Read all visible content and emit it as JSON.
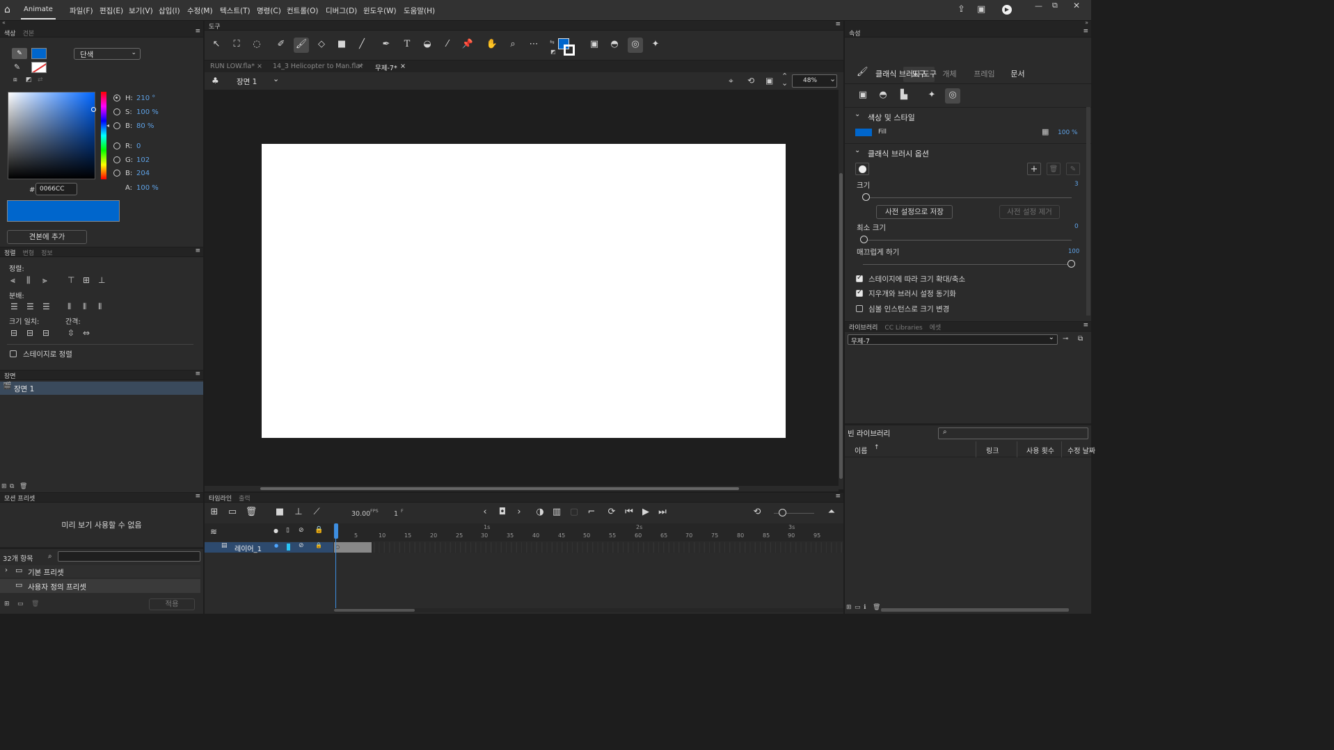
{
  "app": {
    "name": "Animate",
    "menus": [
      "파일(F)",
      "편집(E)",
      "보기(V)",
      "삽입(I)",
      "수정(M)",
      "텍스트(T)",
      "명령(C)",
      "컨트롤(O)",
      "디버그(D)",
      "윈도우(W)",
      "도움말(H)"
    ]
  },
  "color_panel": {
    "tab_active": "색상",
    "tab_inactive": "견본",
    "mode": "단색",
    "H_label": "H:",
    "H": "210 °",
    "S_label": "S:",
    "S": "100 %",
    "B_label": "B:",
    "B": "80 %",
    "R_label": "R:",
    "R": "0",
    "G_label": "G:",
    "G": "102",
    "B2_label": "B:",
    "B2": "204",
    "A_label": "A:",
    "A": "100 %",
    "hex_prefix": "#",
    "hex": "0066CC",
    "add_swatch": "견본에 추가",
    "fill_color": "#0066cc"
  },
  "align_panel": {
    "tab_active": "정렬",
    "tab2": "변형",
    "tab3": "정보",
    "align_label": "정렬:",
    "distribute_label": "분배:",
    "match_size_label": "크기 일치:",
    "space_label": "간격:",
    "to_stage": "스테이지로 정렬"
  },
  "scene_panel": {
    "title": "장면",
    "item": "장면 1"
  },
  "motion_presets": {
    "title": "모션 프리셋",
    "preview": "미리 보기 사용할 수 없음",
    "count": "32개 항목",
    "folder1": "기본 프리셋",
    "folder2": "사용자 정의 프리셋",
    "apply": "적용"
  },
  "tools_panel": {
    "title": "도구",
    "stroke_color": "#0066cc"
  },
  "doc_tabs": [
    {
      "label": "RUN LOW.fla*"
    },
    {
      "label": "14_3 Helicopter to Man.fla*"
    },
    {
      "label": "무제-7*"
    }
  ],
  "edit_bar": {
    "scene": "장면 1",
    "zoom": "48%"
  },
  "timeline": {
    "tab_active": "타임라인",
    "tab2": "출력",
    "fps": "30.00",
    "fps_unit": "FPS",
    "frame": "1",
    "frame_unit": "F",
    "layer_name": "레이어_1",
    "seconds": [
      "1s",
      "2s",
      "3s"
    ],
    "ticks": [
      "5",
      "10",
      "15",
      "20",
      "25",
      "30",
      "35",
      "40",
      "45",
      "50",
      "55",
      "60",
      "65",
      "70",
      "75",
      "80",
      "85",
      "90",
      "95"
    ]
  },
  "properties": {
    "title": "속성",
    "tabs": [
      "도구",
      "개체",
      "프레임",
      "문서"
    ],
    "tool_name": "클래식 브러시 도구",
    "section_color": "색상 및 스타일",
    "fill_label": "Fill",
    "fill_alpha": "100 %",
    "section_brush": "클래식 브러시 옵션",
    "size_label": "크기",
    "size_value": "3",
    "size_level": 0.0,
    "save_preset": "사전 설정으로 저장",
    "remove_preset": "사전 설정 제거",
    "min_size_label": "최소 크기",
    "min_size_value": "0",
    "min_size_level": 0.0,
    "smooth_label": "매끄럽게 하기",
    "smooth_value": "100",
    "smooth_level": 1.0,
    "opt1": "스테이지에 따라 크기 확대/축소",
    "opt2": "지우개와 브러시 설정 동기화",
    "opt3": "심볼 인스턴스로 크기 변경"
  },
  "library": {
    "tab_active": "라이브러리",
    "tab2": "CC Libraries",
    "tab3": "에셋",
    "doc": "무제-7",
    "empty": "빈 라이브러리",
    "col_name": "이름",
    "col_link": "링크",
    "col_uses": "사용 횟수",
    "col_modified": "수정 날짜"
  }
}
